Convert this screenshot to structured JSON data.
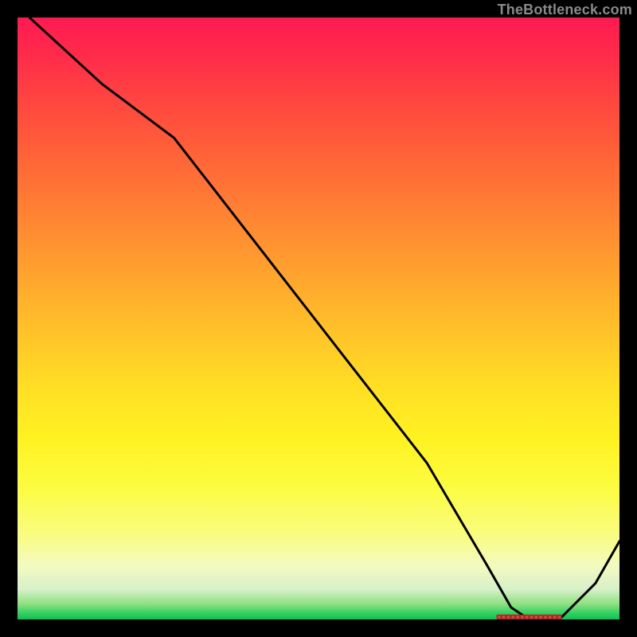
{
  "watermark": "TheBottleneck.com",
  "chart_data": {
    "type": "line",
    "title": "",
    "xlabel": "",
    "ylabel": "",
    "xlim": [
      0,
      100
    ],
    "ylim": [
      0,
      100
    ],
    "series": [
      {
        "name": "curve",
        "x": [
          2,
          14,
          26,
          40,
          54,
          68,
          78,
          82,
          85,
          90,
          96,
          100
        ],
        "y": [
          100,
          89,
          80,
          62,
          44,
          26,
          9,
          2,
          0,
          0,
          6,
          13
        ]
      }
    ],
    "marker_region": {
      "x_start": 80,
      "x_end": 90,
      "y": 0
    }
  }
}
